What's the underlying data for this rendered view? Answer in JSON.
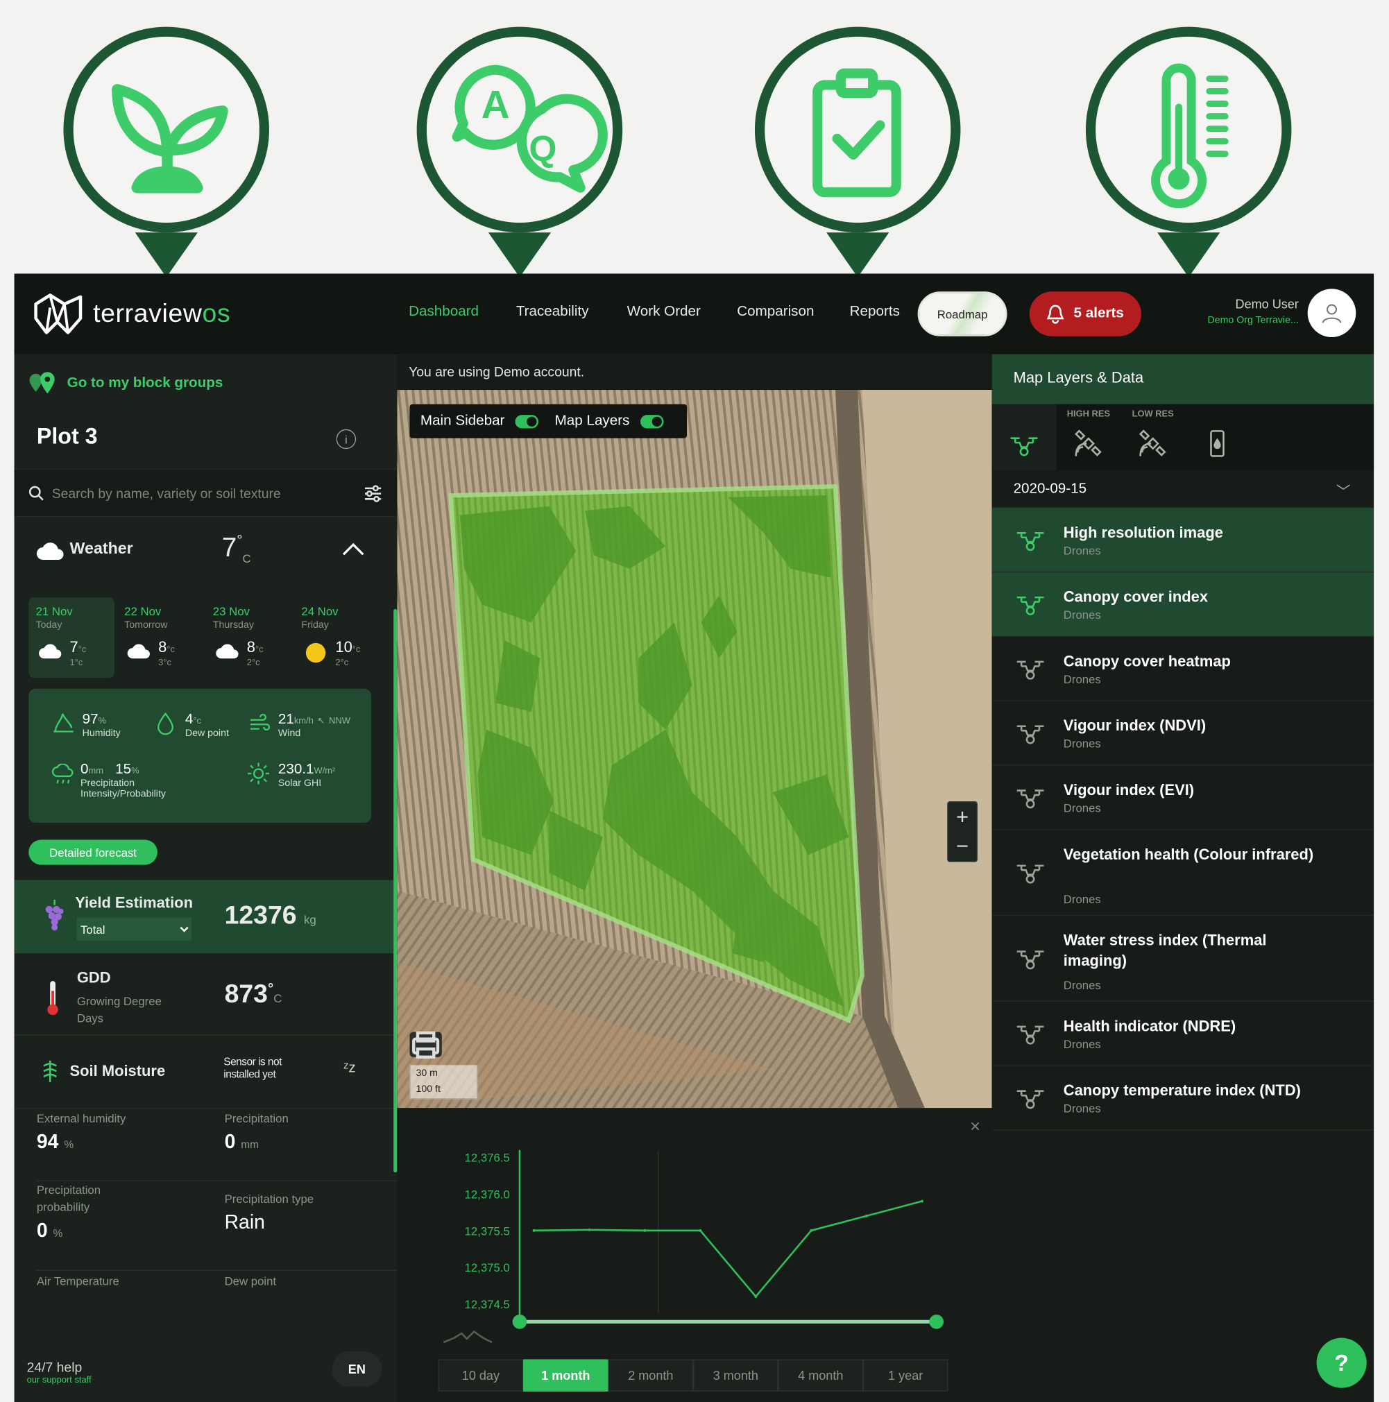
{
  "brand": {
    "name": "terraview",
    "suffix": "os",
    "accent": "#3ecb6a",
    "dark_green": "#1f4a30"
  },
  "pins": [
    {
      "icon": "sprout-icon"
    },
    {
      "icon": "qa-chat-icon"
    },
    {
      "icon": "clipboard-check-icon"
    },
    {
      "icon": "thermometer-icon"
    }
  ],
  "nav": {
    "items": [
      "Dashboard",
      "Traceability",
      "Work Order",
      "Comparison",
      "Reports"
    ],
    "active": "Dashboard",
    "roadmap": "Roadmap",
    "alerts": "5 alerts"
  },
  "user": {
    "name": "Demo User",
    "org": "Demo Org Terravie..."
  },
  "sidebar": {
    "block_groups_link": "Go to my block groups",
    "plot_title": "Plot 3",
    "search_placeholder": "Search by name, variety or soil texture",
    "weather": {
      "label": "Weather",
      "temp": "7",
      "deg": "°",
      "unit": "C",
      "days": [
        {
          "date": "21 Nov",
          "name": "Today",
          "high": "7",
          "low": "1",
          "icon": "cloud-icon"
        },
        {
          "date": "22 Nov",
          "name": "Tomorrow",
          "high": "8",
          "low": "3",
          "icon": "cloud-icon"
        },
        {
          "date": "23 Nov",
          "name": "Thursday",
          "high": "8",
          "low": "2",
          "icon": "cloud-icon"
        },
        {
          "date": "24 Nov",
          "name": "Friday",
          "high": "10",
          "low": "2",
          "icon": "sun-icon"
        }
      ],
      "deg_c": "°c",
      "humidity": {
        "value": "97",
        "unit": "%",
        "label": "Humidity"
      },
      "dew_point": {
        "value": "4",
        "unit": "°c",
        "label": "Dew point"
      },
      "wind": {
        "value": "21",
        "unit": "km/h",
        "dir": "NNW",
        "label": "Wind"
      },
      "precip": {
        "value": "0",
        "unit": "mm",
        "prob": "15",
        "prob_unit": "%",
        "label": "Precipitation Intensity/Probability"
      },
      "solar": {
        "value": "230.1",
        "unit": "W/m²",
        "label": "Solar GHI"
      },
      "forecast_button": "Detailed forecast"
    },
    "yield": {
      "label": "Yield Estimation",
      "select": "Total",
      "value": "12376",
      "unit": "kg"
    },
    "gdd": {
      "label": "GDD",
      "sub": "Growing Degree Days",
      "value": "873",
      "deg": "°",
      "unit": "C"
    },
    "soil": {
      "label": "Soil Moisture",
      "status": "Sensor is not installed yet"
    },
    "cells": [
      {
        "k": "External humidity",
        "v": "94",
        "u": "%"
      },
      {
        "k": "Precipitation",
        "v": "0",
        "u": "mm"
      },
      {
        "k": "Precipitation probability",
        "v": "0",
        "u": "%"
      },
      {
        "k": "Precipitation type",
        "v": "Rain",
        "u": ""
      },
      {
        "k": "Air Temperature",
        "v": "",
        "u": ""
      },
      {
        "k": "Dew point",
        "v": "",
        "u": ""
      }
    ],
    "help": {
      "title": "24/7 help",
      "sub": "our support staff"
    },
    "lang": "EN"
  },
  "center": {
    "demo_message": "You are using Demo account.",
    "toggles": {
      "main_sidebar": "Main Sidebar",
      "map_layers": "Map Layers"
    },
    "scale": {
      "metric": "30 m",
      "imperial": "100 ft"
    },
    "ranges": [
      "10 day",
      "1 month",
      "2 month",
      "3 month",
      "4 month",
      "1 year"
    ],
    "active_range": "1 month"
  },
  "chart_data": {
    "type": "line",
    "title": "",
    "xlabel": "",
    "ylabel": "",
    "ylim": [
      12374.5,
      12376.5
    ],
    "yticks": [
      "12,376.5",
      "12,376.0",
      "12,375.5",
      "12,375.0",
      "12,374.5"
    ],
    "series": [
      {
        "x": [
          0,
          1,
          2,
          3,
          4,
          5,
          6,
          7
        ],
        "values": [
          12375.5,
          12375.51,
          12375.5,
          12375.5,
          12374.6,
          12375.5,
          12375.7,
          12375.9
        ]
      }
    ],
    "color": "#2fbf5d"
  },
  "right": {
    "title": "Map Layers & Data",
    "tabs": [
      {
        "caption": "",
        "icon": "drone-icon"
      },
      {
        "caption": "HIGH RES",
        "icon": "satellite-icon"
      },
      {
        "caption": "LOW RES",
        "icon": "satellite-icon"
      },
      {
        "caption": "",
        "icon": "sensor-icon"
      }
    ],
    "date": "2020-09-15",
    "layers": [
      {
        "title": "High resolution image",
        "source": "Drones"
      },
      {
        "title": "Canopy cover index",
        "source": "Drones"
      },
      {
        "title": "Canopy cover heatmap",
        "source": "Drones"
      },
      {
        "title": "Vigour index (NDVI)",
        "source": "Drones"
      },
      {
        "title": "Vigour index (EVI)",
        "source": "Drones"
      },
      {
        "title": "Vegetation health (Colour infrared)",
        "source": "Drones"
      },
      {
        "title": "Water stress index (Thermal imaging)",
        "source": "Drones"
      },
      {
        "title": "Health indicator (NDRE)",
        "source": "Drones"
      },
      {
        "title": "Canopy temperature index (NTD)",
        "source": "Drones"
      }
    ]
  },
  "fab": "?"
}
